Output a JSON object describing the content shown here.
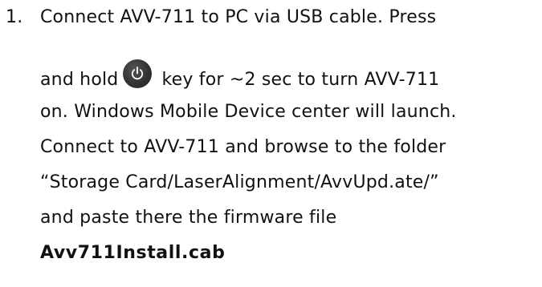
{
  "step": {
    "number": "1.",
    "line1": "Connect AVV-711 to PC via USB cable. Press",
    "line2_before_icon": "and hold",
    "line2_after_icon": "key for ~2 sec to turn AVV-711",
    "line3": "on. Windows Mobile Device center will launch.",
    "line4": "Connect to AVV-711 and browse to the folder",
    "line5": "“Storage Card/LaserAlignment/AvvUpd.ate/”",
    "line6": "and paste there the firmware file",
    "filename": "Avv711Install.cab",
    "icon": "power-icon"
  }
}
